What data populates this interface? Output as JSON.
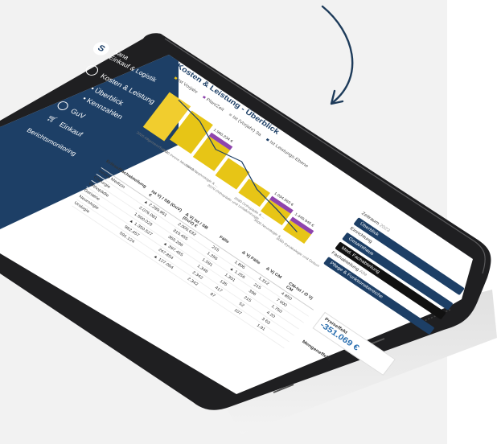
{
  "app": {
    "brand_line1": "Sana",
    "brand_line2": "Einkauf & Logistik",
    "nav": [
      {
        "label": "Kosten & Leistung",
        "icon": "chart-icon"
      },
      {
        "label": "Überblick"
      },
      {
        "label": "Kennzahlen"
      },
      {
        "label": "GuV",
        "icon": "pie-icon"
      },
      {
        "label": "Einkauf",
        "icon": "cart-icon"
      },
      {
        "label": "Berichtsmonitoring"
      }
    ]
  },
  "page": {
    "title": "Kosten & Leistung - Überblick"
  },
  "legend": [
    "Ist Vorjahr",
    "Plan/Zeit",
    "Ist (Vorjahr) 3a",
    "Ist Leistungs-Ebene"
  ],
  "waterfall": {
    "categories": [
      "2020 Allgemein/Sonst",
      "2020 Innere Medizin & ...",
      "3040 Nephrologie & ...",
      "2070 Orthopädie und Unfallchirurgie",
      "2080 Orthopädie & ...",
      "3600 Neurologie & ...",
      "3000 Gynäkologie und Geburtshilfe"
    ],
    "values": [
      "",
      "",
      "1.960.234 €",
      "",
      "",
      "1.034.565 €",
      "1.449.945 €"
    ]
  },
  "controls": {
    "buttons": [
      "Überblick",
      "Gesamthaus",
      "Med. Fachabteilung",
      "Pflege & Funktionsbereiche"
    ],
    "filters": [
      {
        "label": "Zeitraum",
        "value": "2023"
      },
      {
        "label": "Einrichtung",
        "value": ""
      },
      {
        "label": "Fachabteilung",
        "value": "Alle"
      }
    ]
  },
  "table": {
    "headers": [
      "Erlöse/Fachabteilung",
      "Ist Vj / SB (GuV) €",
      "Δ Vj Ist / SB (GuV) €",
      "Fälle",
      "Δ Vj Fälle",
      "Δ Vj CM",
      "CM-Ist / ∅ Vj CM"
    ],
    "rows": [
      [
        "Innere Medizin",
        "▲ 2.299.961",
        "2.000.632",
        "215",
        "1.806",
        "1.312",
        "4 850"
      ],
      [
        "Chirurgie",
        "2.076.081",
        "310.455",
        "1.256",
        "▲ 1.256",
        "215",
        "7 000"
      ],
      [
        "Orthopädie",
        "1.500.023",
        "365.296",
        "1.591",
        "1.301",
        "396",
        "1.750"
      ],
      [
        "Geriatrie",
        "▲ 1.350.527",
        "▲ 397.455",
        "1.348",
        "135",
        "215",
        "4 20"
      ],
      [
        "Neurologie",
        "982.457",
        "247.854",
        "2.342",
        "417",
        "52",
        "3 63"
      ],
      [
        "Urologie",
        "591.124",
        "▲ 127.054",
        "2.342",
        "87",
        "107",
        "1.91"
      ]
    ]
  },
  "kpi": {
    "label": "Preiseffekt",
    "value": "-351.069 €",
    "label2": "Mengeneffekt"
  }
}
